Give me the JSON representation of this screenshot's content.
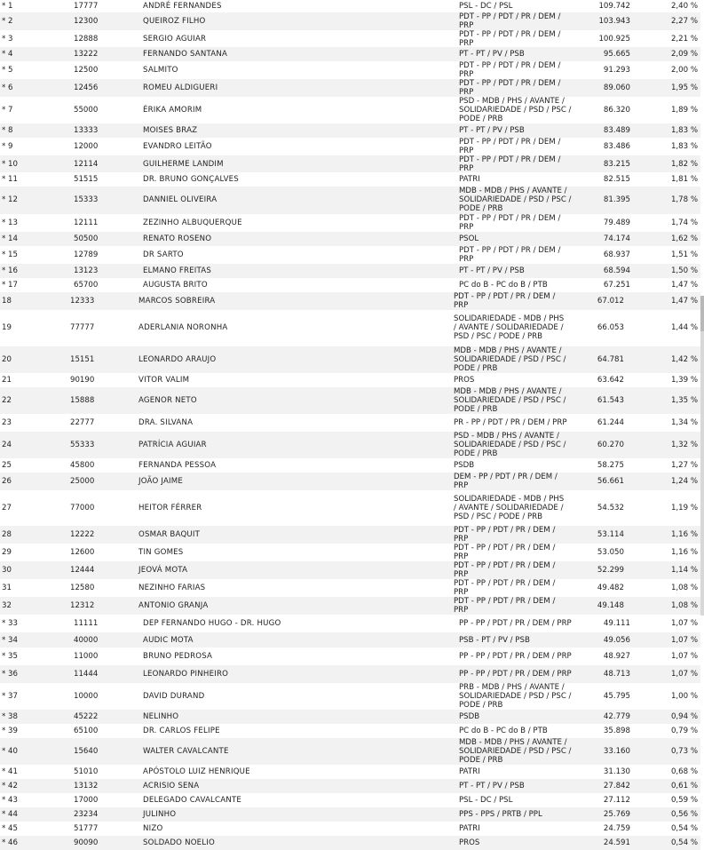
{
  "rows": [
    {
      "rank": "* 1",
      "num": "17777",
      "name": "ANDRÉ FERNANDES",
      "party": "PSL - DC / PSL",
      "votes": "109.742",
      "pct": "2,40 %",
      "h": 14
    },
    {
      "rank": "* 2",
      "num": "12300",
      "name": "QUEIROZ FILHO",
      "party": "PDT - PP / PDT / PR / DEM / PRP",
      "votes": "103.943",
      "pct": "2,27 %",
      "h": 20
    },
    {
      "rank": "* 3",
      "num": "12888",
      "name": "SERGIO AGUIAR",
      "party": "PDT - PP / PDT / PR / DEM / PRP",
      "votes": "100.925",
      "pct": "2,21 %",
      "h": 19
    },
    {
      "rank": "* 4",
      "num": "13222",
      "name": "FERNANDO SANTANA",
      "party": "PT - PT / PV / PSB",
      "votes": "95.665",
      "pct": "2,09 %",
      "h": 16
    },
    {
      "rank": "* 5",
      "num": "12500",
      "name": "SALMITO",
      "party": "PDT - PP / PDT / PR / DEM / PRP",
      "votes": "91.293",
      "pct": "2,00 %",
      "h": 20
    },
    {
      "rank": "* 6",
      "num": "12456",
      "name": "ROMEU ALDIGUERI",
      "party": "PDT - PP / PDT / PR / DEM / PRP",
      "votes": "89.060",
      "pct": "1,95 %",
      "h": 20
    },
    {
      "rank": "* 7",
      "num": "55000",
      "name": "ÉRIKA AMORIM",
      "party": "PSD - MDB / PHS / AVANTE / SOLIDARIEDADE / PSD / PSC / PODE / PRB",
      "votes": "86.320",
      "pct": "1,89 %",
      "h": 30
    },
    {
      "rank": "* 8",
      "num": "13333",
      "name": "MOISES BRAZ",
      "party": "PT - PT / PV / PSB",
      "votes": "83.489",
      "pct": "1,83 %",
      "h": 16
    },
    {
      "rank": "* 9",
      "num": "12000",
      "name": "EVANDRO LEITÃO",
      "party": "PDT - PP / PDT / PR / DEM / PRP",
      "votes": "83.486",
      "pct": "1,83 %",
      "h": 20
    },
    {
      "rank": "* 10",
      "num": "12114",
      "name": "GUILHERME LANDIM",
      "party": "PDT - PP / PDT / PR / DEM / PRP",
      "votes": "83.215",
      "pct": "1,82 %",
      "h": 19
    },
    {
      "rank": "* 11",
      "num": "51515",
      "name": "DR. BRUNO GONÇALVES",
      "party": "PATRI",
      "votes": "82.515",
      "pct": "1,81 %",
      "h": 16
    },
    {
      "rank": "* 12",
      "num": "15333",
      "name": "DANNIEL OLIVEIRA",
      "party": "MDB - MDB / PHS / AVANTE / SOLIDARIEDADE / PSD / PSC / PODE / PRB",
      "votes": "81.395",
      "pct": "1,78 %",
      "h": 30
    },
    {
      "rank": "* 13",
      "num": "12111",
      "name": "ZEZINHO ALBUQUERQUE",
      "party": "PDT - PP / PDT / PR / DEM / PRP",
      "votes": "79.489",
      "pct": "1,74 %",
      "h": 20
    },
    {
      "rank": "* 14",
      "num": "50500",
      "name": "RENATO ROSENO",
      "party": "PSOL",
      "votes": "74.174",
      "pct": "1,62 %",
      "h": 16
    },
    {
      "rank": "* 15",
      "num": "12789",
      "name": "DR SARTO",
      "party": "PDT - PP / PDT / PR / DEM / PRP",
      "votes": "68.937",
      "pct": "1,51 %",
      "h": 20
    },
    {
      "rank": "* 16",
      "num": "13123",
      "name": "ELMANO FREITAS",
      "party": "PT - PT / PV / PSB",
      "votes": "68.594",
      "pct": "1,50 %",
      "h": 16
    },
    {
      "rank": "* 17",
      "num": "65700",
      "name": "AUGUSTA BRITO",
      "party": "PC do B - PC do B / PTB",
      "votes": "67.251",
      "pct": "1,47 %",
      "h": 16
    },
    {
      "rank": "18",
      "num": "12333",
      "name": "MARCOS SOBREIRA",
      "party": "PDT - PP / PDT / PR / DEM / PRP",
      "votes": "67.012",
      "pct": "1,47 %",
      "h": 20
    },
    {
      "rank": "19",
      "num": "77777",
      "name": "ADERLANIA NORONHA",
      "party": "SOLIDARIEDADE - MDB / PHS / AVANTE / SOLIDARIEDADE / PSD / PSC / PODE / PRB",
      "votes": "66.053",
      "pct": "1,44 %",
      "h": 41
    },
    {
      "rank": "20",
      "num": "15151",
      "name": "LEONARDO ARAUJO",
      "party": "MDB - MDB / PHS / AVANTE / SOLIDARIEDADE / PSD / PSC / PODE / PRB",
      "votes": "64.781",
      "pct": "1,42 %",
      "h": 30
    },
    {
      "rank": "21",
      "num": "90190",
      "name": "VITOR VALIM",
      "party": "PROS",
      "votes": "63.642",
      "pct": "1,39 %",
      "h": 16
    },
    {
      "rank": "22",
      "num": "15888",
      "name": "AGENOR NETO",
      "party": "MDB - MDB / PHS / AVANTE / SOLIDARIEDADE / PSD / PSC / PODE / PRB",
      "votes": "61.543",
      "pct": "1,35 %",
      "h": 30
    },
    {
      "rank": "23",
      "num": "22777",
      "name": "DRA. SILVANA",
      "party": "PR - PP / PDT / PR / DEM / PRP",
      "votes": "61.244",
      "pct": "1,34 %",
      "h": 20
    },
    {
      "rank": "24",
      "num": "55333",
      "name": "PATRÍCIA AGUIAR",
      "party": "PSD - MDB / PHS / AVANTE / SOLIDARIEDADE / PSD / PSC / PODE / PRB",
      "votes": "60.270",
      "pct": "1,32 %",
      "h": 30
    },
    {
      "rank": "25",
      "num": "45800",
      "name": "FERNANDA PESSOA",
      "party": "PSDB",
      "votes": "58.275",
      "pct": "1,27 %",
      "h": 16
    },
    {
      "rank": "26",
      "num": "25000",
      "name": "JOÃO JAIME",
      "party": "DEM - PP / PDT / PR / DEM / PRP",
      "votes": "56.661",
      "pct": "1,24 %",
      "h": 20
    },
    {
      "rank": "27",
      "num": "77000",
      "name": "HEITOR FÉRRER",
      "party": "SOLIDARIEDADE - MDB / PHS / AVANTE / SOLIDARIEDADE / PSD / PSC / PODE / PRB",
      "votes": "54.532",
      "pct": "1,19 %",
      "h": 40
    },
    {
      "rank": "28",
      "num": "12222",
      "name": "OSMAR BAQUIT",
      "party": "PDT - PP / PDT / PR / DEM / PRP",
      "votes": "53.114",
      "pct": "1,16 %",
      "h": 20
    },
    {
      "rank": "29",
      "num": "12600",
      "name": "TIN GOMES",
      "party": "PDT - PP / PDT / PR / DEM / PRP",
      "votes": "53.050",
      "pct": "1,16 %",
      "h": 20
    },
    {
      "rank": "30",
      "num": "12444",
      "name": "JEOVÁ MOTA",
      "party": "PDT - PP / PDT / PR / DEM / PRP",
      "votes": "52.299",
      "pct": "1,14 %",
      "h": 20
    },
    {
      "rank": "31",
      "num": "12580",
      "name": "NEZINHO FARIAS",
      "party": "PDT - PP / PDT / PR / DEM / PRP",
      "votes": "49.482",
      "pct": "1,08 %",
      "h": 20
    },
    {
      "rank": "32",
      "num": "12312",
      "name": "ANTONIO GRANJA",
      "party": "PDT - PP / PDT / PR / DEM / PRP",
      "votes": "49.148",
      "pct": "1,08 %",
      "h": 20
    },
    {
      "rank": "* 33",
      "num": "11111",
      "name": "DEP FERNANDO HUGO - DR. HUGO",
      "party": "PP - PP / PDT / PR / DEM / PRP",
      "votes": "49.111",
      "pct": "1,07 %",
      "h": 20
    },
    {
      "rank": "* 34",
      "num": "40000",
      "name": "AUDIC MOTA",
      "party": "PSB - PT / PV / PSB",
      "votes": "49.056",
      "pct": "1,07 %",
      "h": 16
    },
    {
      "rank": "* 35",
      "num": "11000",
      "name": "BRUNO PEDROSA",
      "party": "PP - PP / PDT / PR / DEM / PRP",
      "votes": "48.927",
      "pct": "1,07 %",
      "h": 20
    },
    {
      "rank": "* 36",
      "num": "11444",
      "name": "LEONARDO PINHEIRO",
      "party": "PP - PP / PDT / PR / DEM / PRP",
      "votes": "48.713",
      "pct": "1,07 %",
      "h": 20
    },
    {
      "rank": "* 37",
      "num": "10000",
      "name": "DAVID DURAND",
      "party": "PRB - MDB / PHS / AVANTE / SOLIDARIEDADE / PSD / PSC / PODE / PRB",
      "votes": "45.795",
      "pct": "1,00 %",
      "h": 30
    },
    {
      "rank": "* 38",
      "num": "45222",
      "name": "NELINHO",
      "party": "PSDB",
      "votes": "42.779",
      "pct": "0,94 %",
      "h": 16
    },
    {
      "rank": "* 39",
      "num": "65100",
      "name": "DR. CARLOS FELIPE",
      "party": "PC do B - PC do B / PTB",
      "votes": "35.898",
      "pct": "0,79 %",
      "h": 16
    },
    {
      "rank": "* 40",
      "num": "15640",
      "name": "WALTER CAVALCANTE",
      "party": "MDB - MDB / PHS / AVANTE / SOLIDARIEDADE / PSD / PSC / PODE / PRB",
      "votes": "33.160",
      "pct": "0,73 %",
      "h": 30
    },
    {
      "rank": "* 41",
      "num": "51010",
      "name": "APÓSTOLO LUIZ HENRIQUE",
      "party": "PATRI",
      "votes": "31.130",
      "pct": "0,68 %",
      "h": 16
    },
    {
      "rank": "* 42",
      "num": "13132",
      "name": "ACRISIO SENA",
      "party": "PT - PT / PV / PSB",
      "votes": "27.842",
      "pct": "0,61 %",
      "h": 16
    },
    {
      "rank": "* 43",
      "num": "17000",
      "name": "DELEGADO CAVALCANTE",
      "party": "PSL - DC / PSL",
      "votes": "27.112",
      "pct": "0,59 %",
      "h": 16
    },
    {
      "rank": "* 44",
      "num": "23234",
      "name": "JULINHO",
      "party": "PPS - PPS / PRTB / PPL",
      "votes": "25.769",
      "pct": "0,56 %",
      "h": 16
    },
    {
      "rank": "* 45",
      "num": "51777",
      "name": "NIZO",
      "party": "PATRI",
      "votes": "24.759",
      "pct": "0,54 %",
      "h": 16
    },
    {
      "rank": "* 46",
      "num": "90090",
      "name": "SOLDADO NOELIO",
      "party": "PROS",
      "votes": "24.591",
      "pct": "0,54 %",
      "h": 16
    }
  ]
}
